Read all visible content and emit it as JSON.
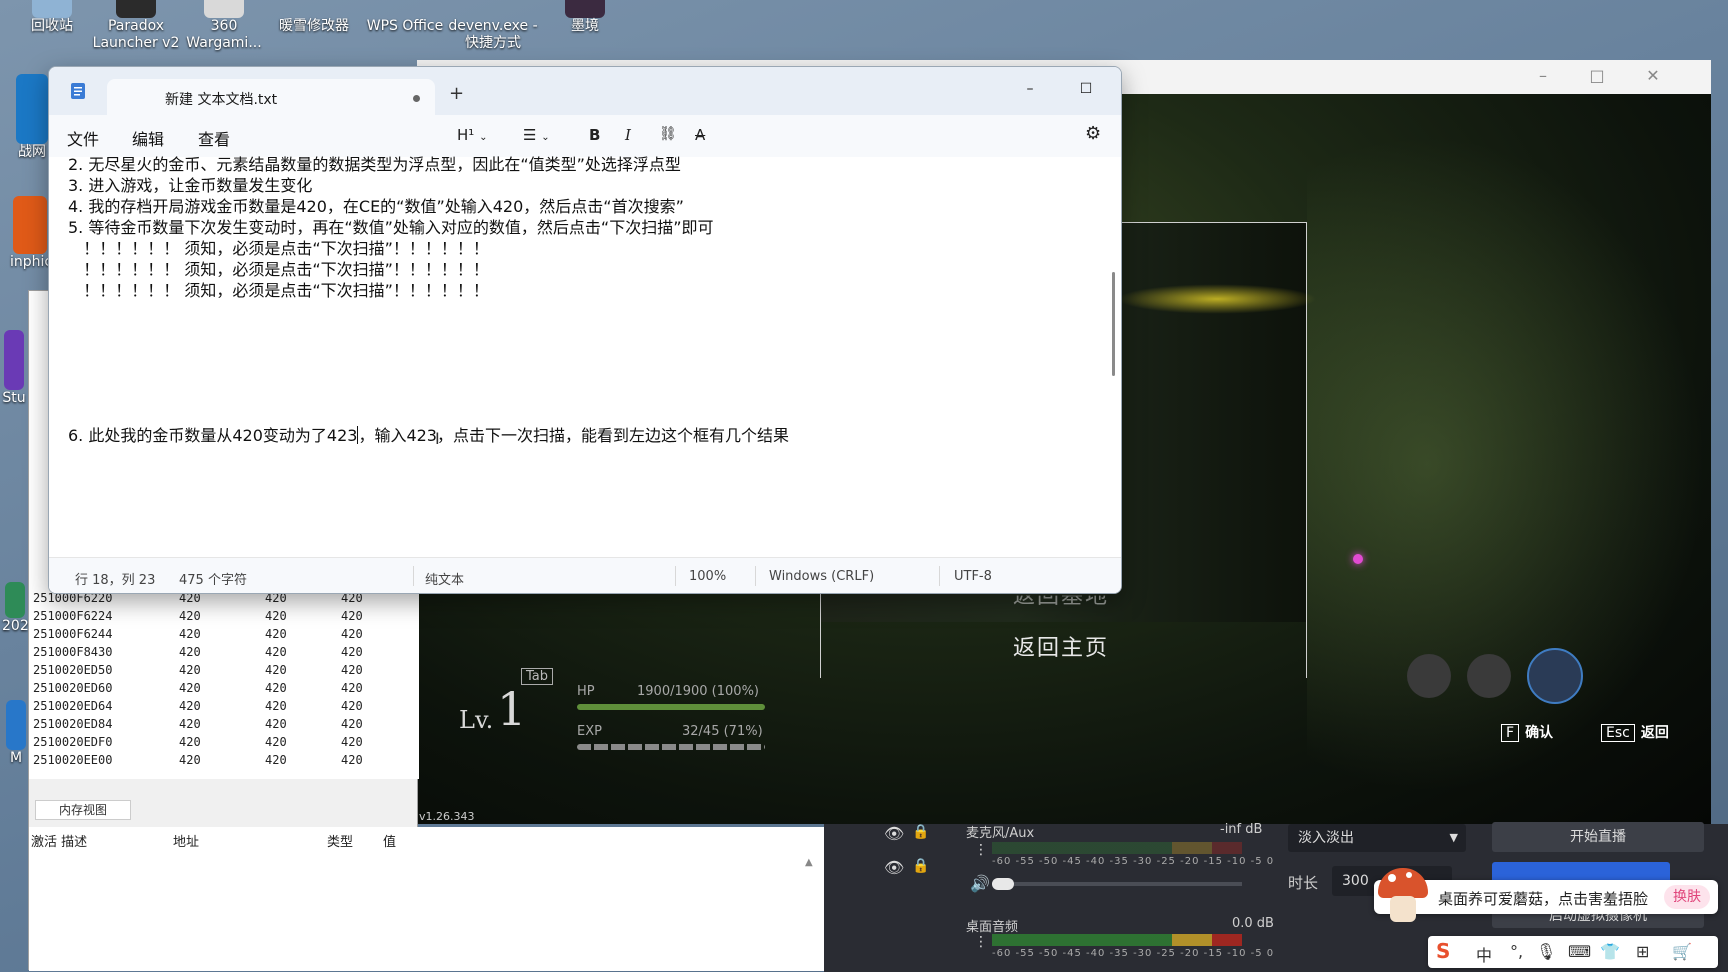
{
  "desktop": {
    "icons": [
      {
        "label": "回收站"
      },
      {
        "label": "Paradox Launcher v2"
      },
      {
        "label": "360 Wargami..."
      },
      {
        "label": "暖雪修改器"
      },
      {
        "label": "WPS Office"
      },
      {
        "label": "devenv.exe - 快捷方式"
      },
      {
        "label": "墨境"
      }
    ],
    "side_labels": [
      "战网",
      "inphic",
      "Stu",
      "202",
      "M"
    ]
  },
  "notepad": {
    "tab_title": "新建 文本文档.txt",
    "new_tab": "+",
    "menu": {
      "file": "文件",
      "edit": "编辑",
      "view": "查看"
    },
    "toolbar": {
      "heading": "H¹",
      "list": "☰",
      "bold": "B",
      "italic": "I",
      "link": "🔗",
      "clear": "A"
    },
    "lines": [
      "2. 无尽星火的金币、元素结晶数量的数据类型为浮点型，因此在“值类型”处选择浮点型",
      "3. 进入游戏，让金币数量发生变化",
      "4. 我的存档开局游戏金币数量是420，在CE的“数值”处输入420，然后点击“首次搜索”",
      "5. 等待金币数量下次发生变动时，再在“数值”处输入对应的数值，然后点击“下次扫描”即可",
      "   ！！！！！！ 须知，必须是点击“下次扫描”！！！！！！",
      "   ！！！！！！ 须知，必须是点击“下次扫描”！！！！！！",
      "   ！！！！！！ 须知，必须是点击“下次扫描”！！！！！！"
    ],
    "line6_before": "6. 此处我的金币数量从420变动为了423",
    "line6_after": "，输入423，点击下一次扫描，能看到左边这个框有几个结果",
    "status": {
      "position": "行 18，列 23",
      "chars": "475 个字符",
      "format": "纯文本",
      "zoom": "100%",
      "line_ending": "Windows (CRLF)",
      "encoding": "UTF-8"
    }
  },
  "cheat_engine": {
    "rows": [
      {
        "address": "251000F6220",
        "value": "420",
        "previous": "420",
        "first": "420"
      },
      {
        "address": "251000F6224",
        "value": "420",
        "previous": "420",
        "first": "420"
      },
      {
        "address": "251000F6244",
        "value": "420",
        "previous": "420",
        "first": "420"
      },
      {
        "address": "251000F8430",
        "value": "420",
        "previous": "420",
        "first": "420"
      },
      {
        "address": "2510020ED50",
        "value": "420",
        "previous": "420",
        "first": "420"
      },
      {
        "address": "2510020ED60",
        "value": "420",
        "previous": "420",
        "first": "420"
      },
      {
        "address": "2510020ED64",
        "value": "420",
        "previous": "420",
        "first": "420"
      },
      {
        "address": "2510020ED84",
        "value": "420",
        "previous": "420",
        "first": "420"
      },
      {
        "address": "2510020EDF0",
        "value": "420",
        "previous": "420",
        "first": "420"
      },
      {
        "address": "2510020EE00",
        "value": "420",
        "previous": "420",
        "first": "420"
      }
    ],
    "memory_view_button": "内存视图",
    "table_headers": {
      "active_desc": "激活 描述",
      "address": "地址",
      "type": "类型",
      "value": "值"
    }
  },
  "game": {
    "menu": {
      "return_home": "返回主页",
      "partial": "返回基地"
    },
    "hud": {
      "level": "1",
      "level_prefix": "Lv.",
      "tab_key": "Tab",
      "hp_label": "HP",
      "hp_value": "1900/1900 (100%)",
      "exp_label": "EXP",
      "exp_value": "32/45 (71%)"
    },
    "hints": {
      "confirm_key": "F",
      "confirm": "确认",
      "back_key": "Esc",
      "back": "返回"
    },
    "version": "v1.26.343"
  },
  "obs": {
    "aux_label": "麦克风/Aux",
    "aux_db": "-inf dB",
    "desktop_label": "桌面音频",
    "desktop_db": "0.0 dB",
    "scale": "-60 -55 -50 -45 -40 -35 -30 -25 -20 -15 -10 -5 0",
    "transition": "淡入淡出",
    "duration_label": "时长",
    "duration_value": "300",
    "start_stream": "开始直播",
    "virtual_cam": "启动虚拟摄像机"
  },
  "mushroom_toast": {
    "message": "桌面养可爱蘑菇，点击害羞捂脸",
    "action": "换肤"
  },
  "ime": {
    "lang": "中",
    "punct": "°,",
    "mic": "🎙",
    "keyboard": "⌨",
    "shirt": "👕",
    "grid": "⊞",
    "cart": "🛒"
  }
}
